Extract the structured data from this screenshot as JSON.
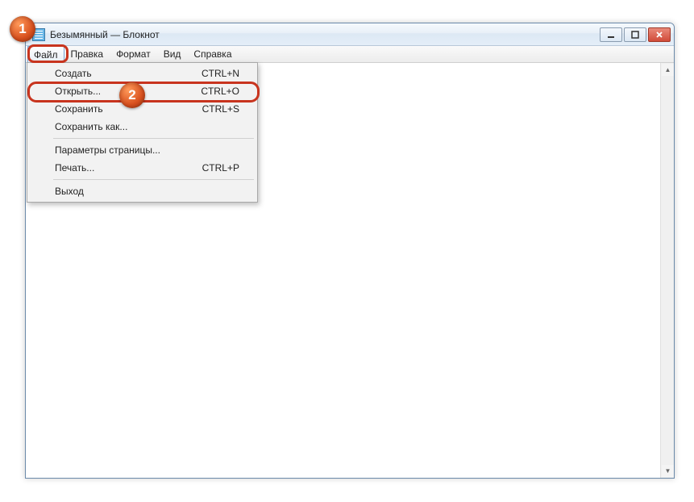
{
  "window": {
    "title": "Безымянный — Блокнот"
  },
  "menubar": {
    "items": [
      {
        "label": "Файл"
      },
      {
        "label": "Правка"
      },
      {
        "label": "Формат"
      },
      {
        "label": "Вид"
      },
      {
        "label": "Справка"
      }
    ]
  },
  "file_menu": {
    "groups": [
      [
        {
          "label": "Создать",
          "shortcut": "CTRL+N"
        },
        {
          "label": "Открыть...",
          "shortcut": "CTRL+O"
        },
        {
          "label": "Сохранить",
          "shortcut": "CTRL+S"
        },
        {
          "label": "Сохранить как...",
          "shortcut": ""
        }
      ],
      [
        {
          "label": "Параметры страницы...",
          "shortcut": ""
        },
        {
          "label": "Печать...",
          "shortcut": "CTRL+P"
        }
      ],
      [
        {
          "label": "Выход",
          "shortcut": ""
        }
      ]
    ]
  },
  "callouts": {
    "one": "1",
    "two": "2"
  }
}
